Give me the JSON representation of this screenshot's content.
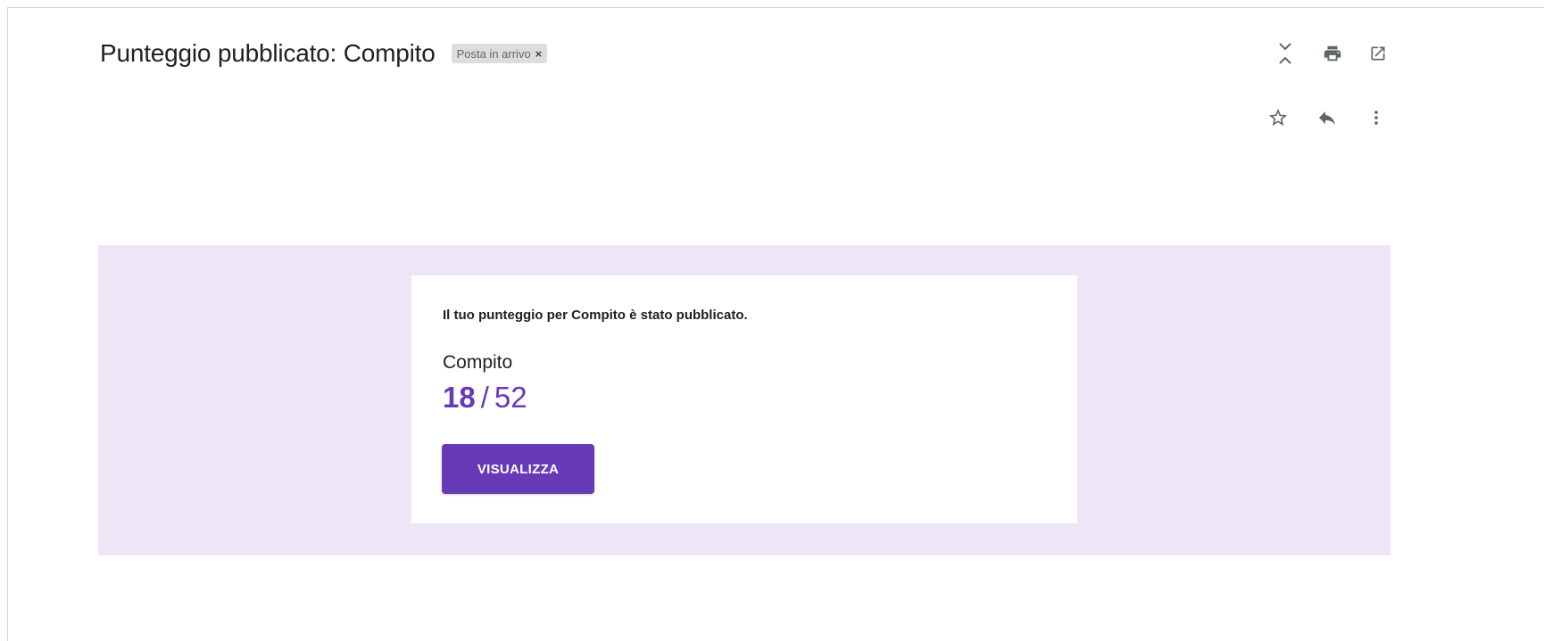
{
  "header": {
    "subject": "Punteggio pubblicato: Compito",
    "label_chip": "Posta in arrivo",
    "label_chip_remove": "×"
  },
  "toolbar": {
    "icons": [
      "expand-collapse-icon",
      "print-icon",
      "open-new-window-icon",
      "star-icon",
      "reply-icon",
      "more-vert-icon"
    ]
  },
  "card": {
    "message": "Il tuo punteggio per Compito è stato pubblicato.",
    "assignment": "Compito",
    "score_earned": "18",
    "score_separator": "/",
    "score_total": "52",
    "button_label": "VISUALIZZA"
  },
  "colors": {
    "accent": "#673ab7",
    "banner_background": "#ede6f6",
    "card_background": "#ffffff",
    "chip_background": "#dddddd"
  }
}
